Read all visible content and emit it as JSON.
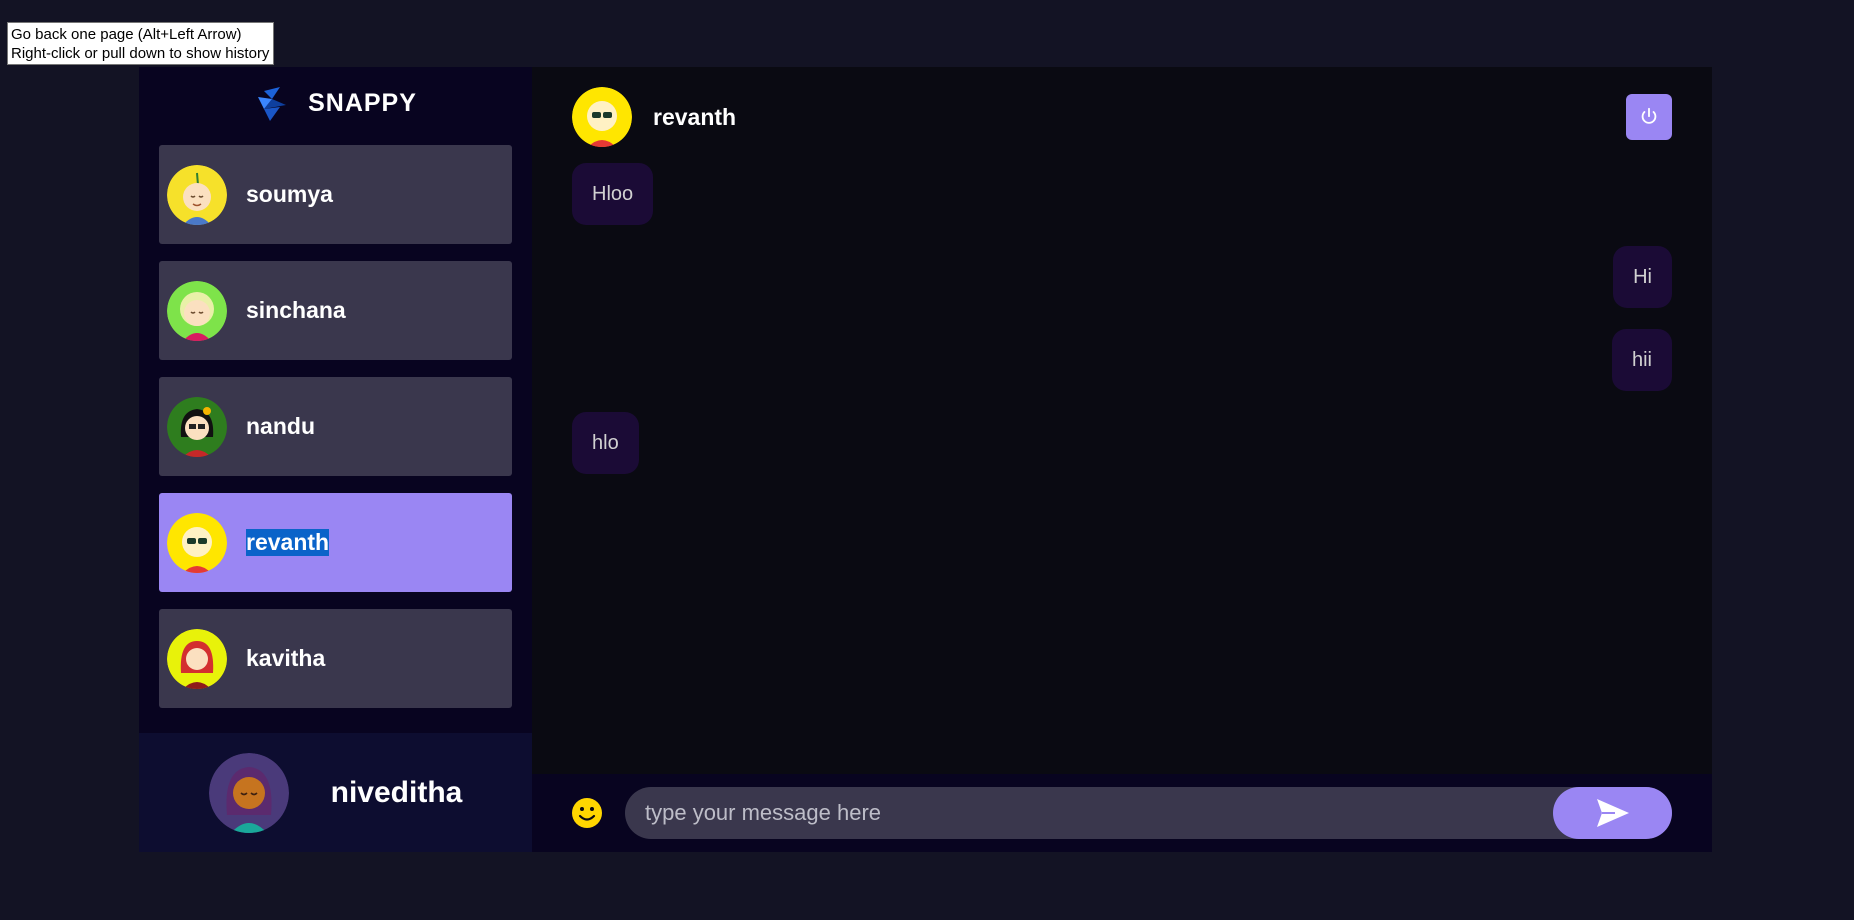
{
  "tooltip": {
    "line1": "Go back one page (Alt+Left Arrow)",
    "line2": "Right-click or pull down to show history"
  },
  "brand": {
    "name": "SNAPPY"
  },
  "contacts": [
    {
      "name": "soumya",
      "avatar": "avatar-soumya"
    },
    {
      "name": "sinchana",
      "avatar": "avatar-sinchana"
    },
    {
      "name": "nandu",
      "avatar": "avatar-nandu"
    },
    {
      "name": "revanth",
      "avatar": "avatar-revanth",
      "selected": true
    },
    {
      "name": "kavitha",
      "avatar": "avatar-kavitha"
    }
  ],
  "current_user": {
    "name": "niveditha"
  },
  "chat": {
    "header_name": "revanth",
    "messages": [
      {
        "text": "Hloo",
        "direction": "received"
      },
      {
        "text": "Hi",
        "direction": "sent"
      },
      {
        "text": "hii",
        "direction": "sent"
      },
      {
        "text": "hlo",
        "direction": "received"
      }
    ],
    "input_placeholder": "type your message here"
  },
  "colors": {
    "accent": "#9a86f3",
    "sidebar_bg": "#080420",
    "bubble_bg": "#1b0b36",
    "page_bg": "#131324"
  },
  "icons": {
    "logout": "power-icon",
    "emoji": "smiley-icon",
    "send": "send-icon",
    "logo": "snappy-logo-icon"
  }
}
